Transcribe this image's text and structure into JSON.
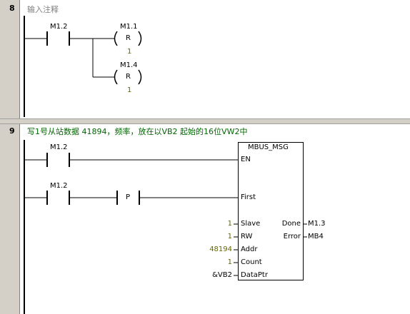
{
  "networks": [
    {
      "number": "8",
      "comment": "输入注释",
      "contact": {
        "address": "M1.2"
      },
      "coils": [
        {
          "address": "M1.1",
          "type": "R",
          "count": "1"
        },
        {
          "address": "M1.4",
          "type": "R",
          "count": "1"
        }
      ]
    },
    {
      "number": "9",
      "comment": "写1号从站数据 41894，频率，放在以VB2 起始的16位VW2中",
      "contact_en": {
        "address": "M1.2"
      },
      "contact_first": {
        "address": "M1.2",
        "edge": "P"
      },
      "block": {
        "title": "MBUS_MSG",
        "inputs": [
          {
            "pin": "EN",
            "value": ""
          },
          {
            "pin": "First",
            "value": ""
          },
          {
            "pin": "Slave",
            "value": "1"
          },
          {
            "pin": "RW",
            "value": "1"
          },
          {
            "pin": "Addr",
            "value": "48194"
          },
          {
            "pin": "Count",
            "value": "1"
          },
          {
            "pin": "DataPtr",
            "value": "&VB2"
          }
        ],
        "outputs": [
          {
            "pin": "Done",
            "value": "M1.3"
          },
          {
            "pin": "Error",
            "value": "MB4"
          }
        ]
      }
    }
  ]
}
